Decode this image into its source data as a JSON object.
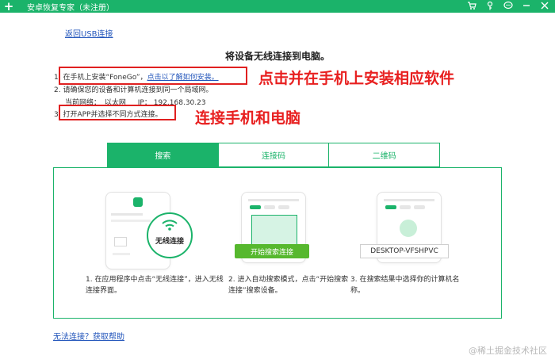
{
  "window": {
    "title": "安卓恢复专家（未注册）"
  },
  "nav": {
    "back_link": "返回USB连接"
  },
  "page": {
    "title": "将设备无线连接到电脑。"
  },
  "steps": [
    {
      "num": "1.",
      "text": "在手机上安装“FoneGo”，",
      "link": "点击以了解如何安装。"
    },
    {
      "num": "2.",
      "text": "请确保您的设备和计算机连接到同一个局域网。"
    },
    {
      "num": "3.",
      "text": "打开APP并选择不同方式连接。"
    }
  ],
  "network": {
    "label": "当前网络：",
    "type": "以太网",
    "ip_label": "IP：",
    "ip": "192.168.30.23"
  },
  "annotations": {
    "top": "点击并在手机上安装相应软件",
    "bottom": "连接手机和电脑"
  },
  "tabs": [
    {
      "label": "搜索",
      "active": true
    },
    {
      "label": "连接码",
      "active": false
    },
    {
      "label": "二维码",
      "active": false
    }
  ],
  "cards": [
    {
      "wifi_label": "无线连接",
      "caption": "1. 在应用程序中点击“无线连接”，进入无线连接界面。"
    },
    {
      "button_label": "开始搜索连接",
      "caption": "2. 进入自动搜索模式，点击“开始搜索连接”搜索设备。"
    },
    {
      "device_name": "DESKTOP-VFSHPVC",
      "caption": "3. 在搜索结果中选择你的计算机名称。"
    }
  ],
  "help_link": "无法连接？获取帮助",
  "watermark": "@稀土掘金技术社区",
  "colors": {
    "brand": "#1bb36a",
    "annotation": "#e02020",
    "link": "#2255bb"
  },
  "icons": [
    "logo-plus-icon",
    "cart-icon",
    "key-icon",
    "chat-icon",
    "minimize-icon",
    "close-icon",
    "wifi-icon",
    "fonego-app-icon"
  ]
}
